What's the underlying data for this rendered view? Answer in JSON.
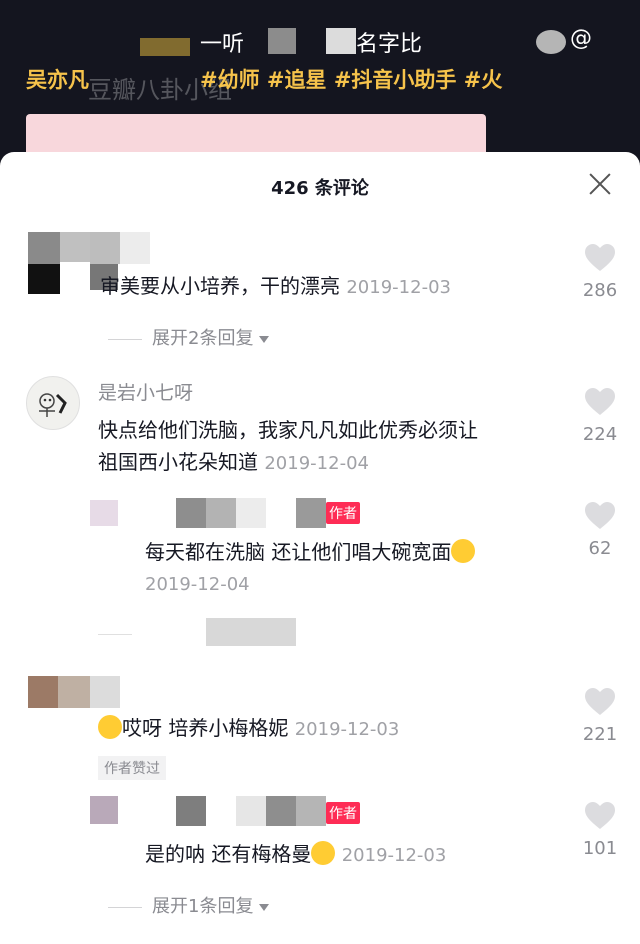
{
  "video": {
    "caption_line1": "一听",
    "caption_line1_mid": "名字比",
    "caption_at": "@",
    "caption_name": "吴亦凡",
    "hashtags": "#幼师 #追星 #抖音小助手 #火",
    "watermark": "豆瓣八卦小组"
  },
  "sheet": {
    "title": "426 条评论"
  },
  "comments": [
    {
      "text": "审美要从小培养，干的漂亮",
      "date": "2019-12-03",
      "likes": "286",
      "expand": "展开2条回复"
    },
    {
      "username": "是岩小七呀",
      "text_line1": "快点给他们洗脑，我家凡凡如此优秀必须让",
      "text_line2": "祖国西小花朵知道",
      "date": "2019-12-04",
      "likes": "224",
      "reply": {
        "author_tag": "作者",
        "text": "每天都在洗脑 还让他们唱大碗宽面",
        "date": "2019-12-04",
        "likes": "62"
      }
    },
    {
      "text": "哎呀 培养小梅格妮",
      "date": "2019-12-03",
      "likes": "221",
      "liked_by_author": "作者赞过",
      "reply": {
        "author_tag": "作者",
        "text": "是的呐 还有梅格曼",
        "date": "2019-12-03",
        "likes": "101"
      },
      "expand": "展开1条回复"
    }
  ],
  "colors": {
    "accent_yellow": "#f6c34b",
    "author_tag": "#fe2c55",
    "secondary_text": "#8a8b91"
  }
}
